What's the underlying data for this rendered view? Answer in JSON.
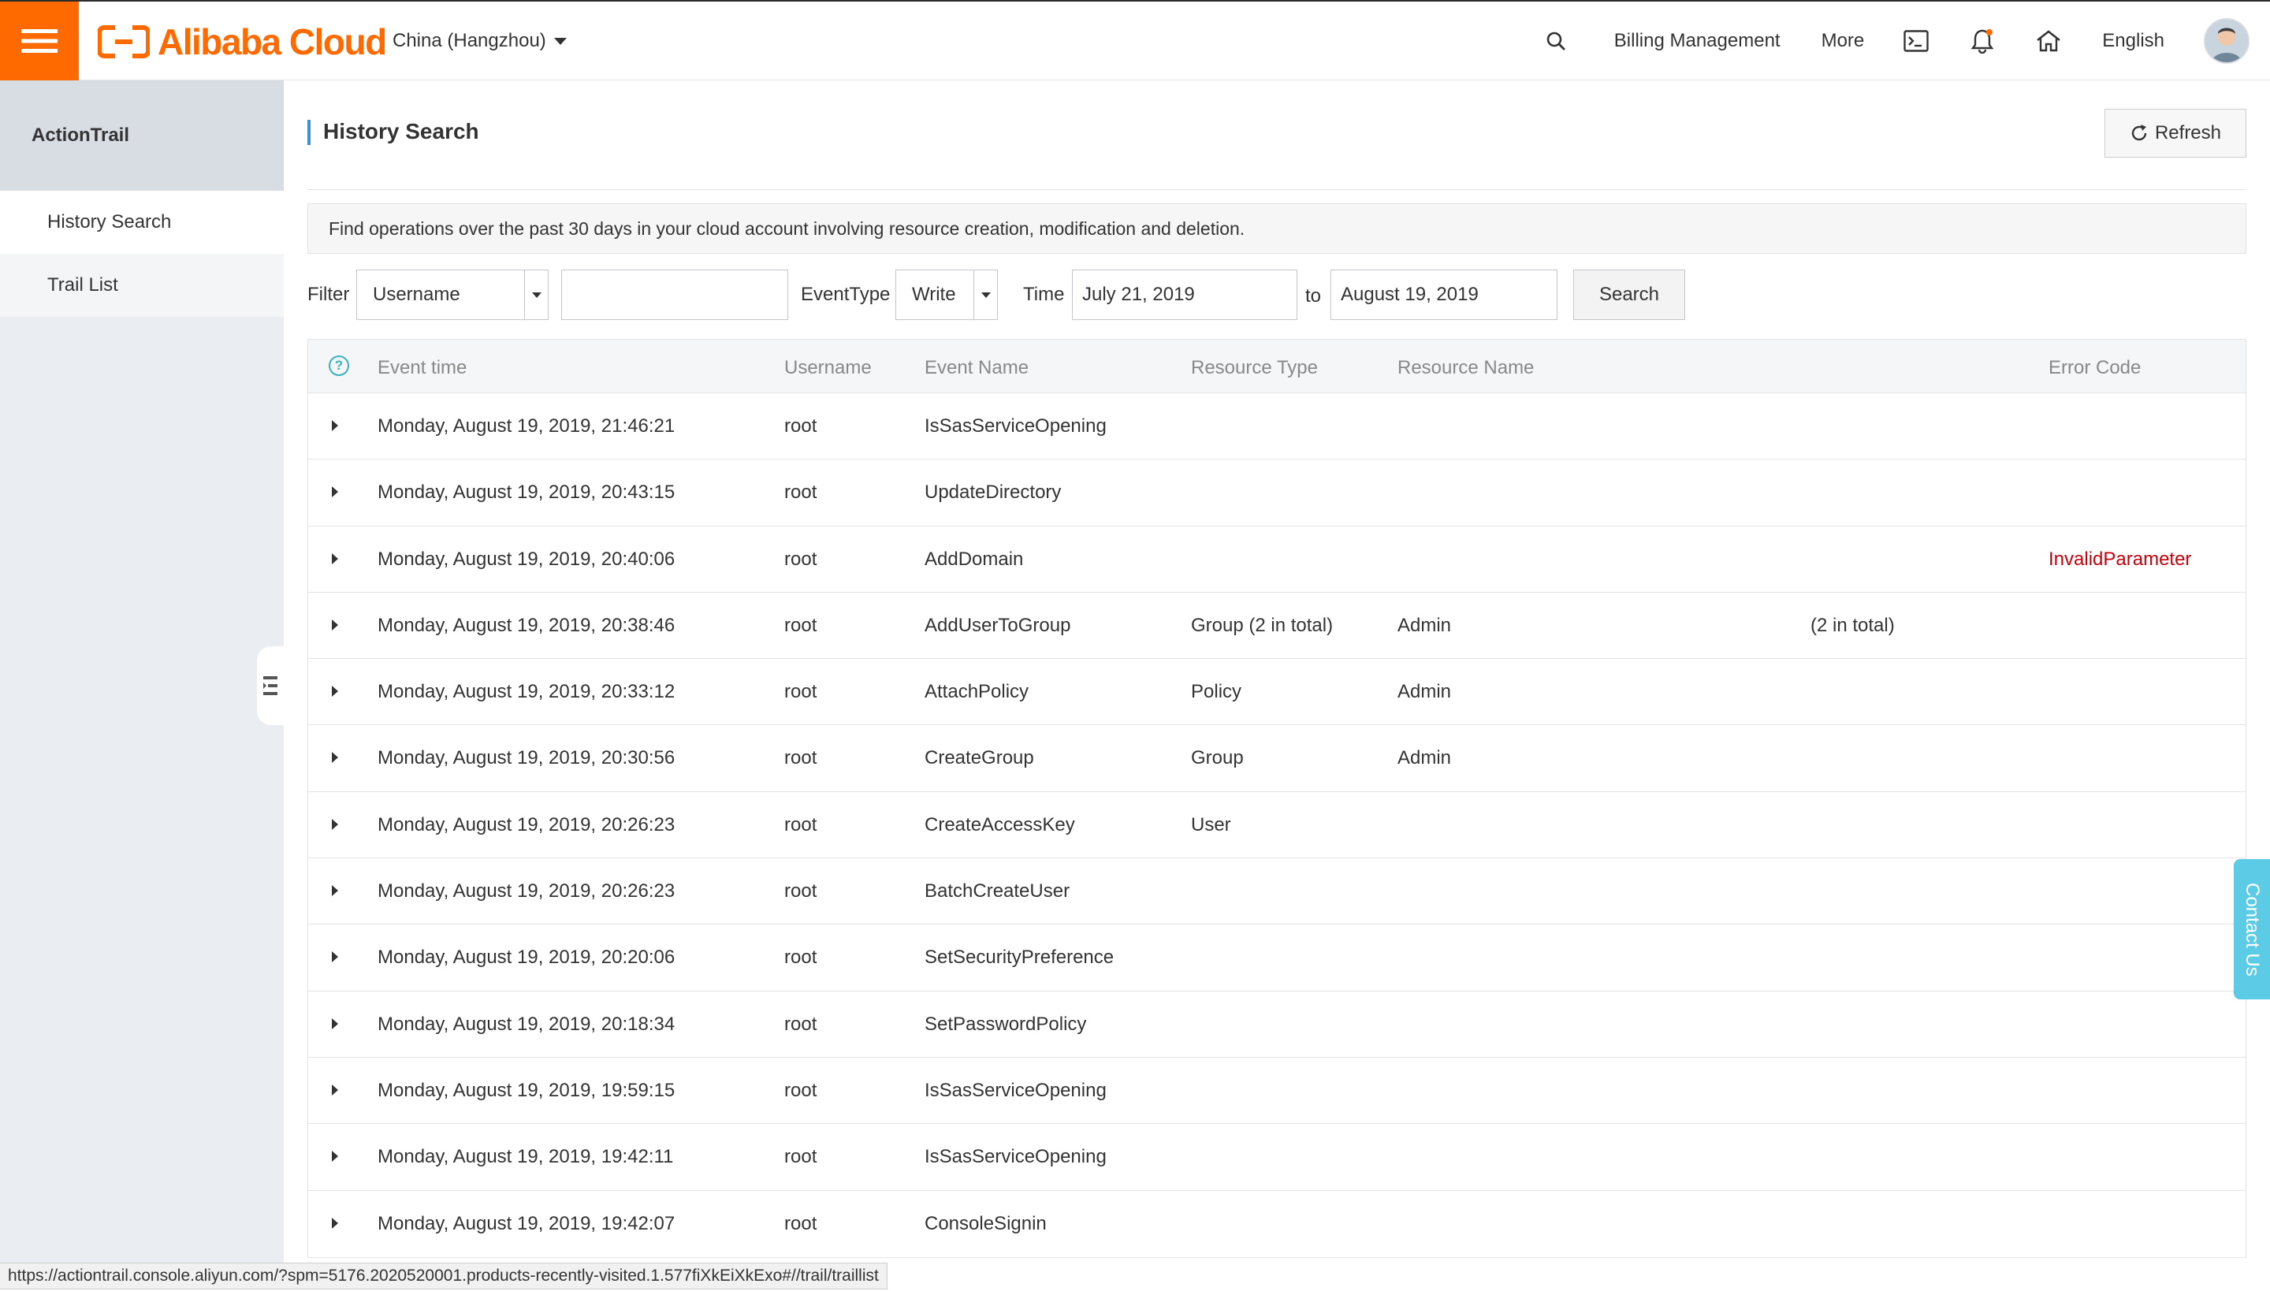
{
  "topbar": {
    "brand": "Alibaba Cloud",
    "region": "China (Hangzhou)",
    "billing": "Billing Management",
    "more": "More",
    "language": "English"
  },
  "sidebar": {
    "title": "ActionTrail",
    "items": [
      {
        "label": "History Search"
      },
      {
        "label": "Trail List"
      }
    ]
  },
  "page": {
    "title": "History Search",
    "refresh_label": "Refresh",
    "notice": "Find operations over the past 30 days in your cloud account involving resource creation, modification and deletion."
  },
  "filters": {
    "filter_label": "Filter",
    "filter_select": "Username",
    "filter_value": "",
    "eventtype_label": "EventType",
    "eventtype_select": "Write",
    "time_label": "Time",
    "start_date": "July 21, 2019",
    "to_label": "to",
    "end_date": "August 19, 2019",
    "search_label": "Search"
  },
  "table": {
    "headers": {
      "event_time": "Event time",
      "username": "Username",
      "event_name": "Event Name",
      "resource_type": "Resource Type",
      "resource_name": "Resource Name",
      "error_code": "Error Code"
    },
    "rows": [
      {
        "time": "Monday, August 19, 2019, 21:46:21",
        "user": "root",
        "event": "IsSasServiceOpening",
        "rtype": "",
        "rname": "",
        "extra": "",
        "error": ""
      },
      {
        "time": "Monday, August 19, 2019, 20:43:15",
        "user": "root",
        "event": "UpdateDirectory",
        "rtype": "",
        "rname": "",
        "extra": "",
        "error": ""
      },
      {
        "time": "Monday, August 19, 2019, 20:40:06",
        "user": "root",
        "event": "AddDomain",
        "rtype": "",
        "rname": "",
        "extra": "",
        "error": "InvalidParameter"
      },
      {
        "time": "Monday, August 19, 2019, 20:38:46",
        "user": "root",
        "event": "AddUserToGroup",
        "rtype": "Group (2 in total)",
        "rname": "Admin",
        "extra": "(2 in total)",
        "error": ""
      },
      {
        "time": "Monday, August 19, 2019, 20:33:12",
        "user": "root",
        "event": "AttachPolicy",
        "rtype": "Policy",
        "rname": "Admin",
        "extra": "",
        "error": ""
      },
      {
        "time": "Monday, August 19, 2019, 20:30:56",
        "user": "root",
        "event": "CreateGroup",
        "rtype": "Group",
        "rname": "Admin",
        "extra": "",
        "error": ""
      },
      {
        "time": "Monday, August 19, 2019, 20:26:23",
        "user": "root",
        "event": "CreateAccessKey",
        "rtype": "User",
        "rname": "",
        "extra": "",
        "error": ""
      },
      {
        "time": "Monday, August 19, 2019, 20:26:23",
        "user": "root",
        "event": "BatchCreateUser",
        "rtype": "",
        "rname": "",
        "extra": "",
        "error": ""
      },
      {
        "time": "Monday, August 19, 2019, 20:20:06",
        "user": "root",
        "event": "SetSecurityPreference",
        "rtype": "",
        "rname": "",
        "extra": "",
        "error": ""
      },
      {
        "time": "Monday, August 19, 2019, 20:18:34",
        "user": "root",
        "event": "SetPasswordPolicy",
        "rtype": "",
        "rname": "",
        "extra": "",
        "error": ""
      },
      {
        "time": "Monday, August 19, 2019, 19:59:15",
        "user": "root",
        "event": "IsSasServiceOpening",
        "rtype": "",
        "rname": "",
        "extra": "",
        "error": ""
      },
      {
        "time": "Monday, August 19, 2019, 19:42:11",
        "user": "root",
        "event": "IsSasServiceOpening",
        "rtype": "",
        "rname": "",
        "extra": "",
        "error": ""
      },
      {
        "time": "Monday, August 19, 2019, 19:42:07",
        "user": "root",
        "event": "ConsoleSignin",
        "rtype": "",
        "rname": "",
        "extra": "",
        "error": ""
      }
    ]
  },
  "status_bar": "https://actiontrail.console.aliyun.com/?spm=5176.2020520001.products-recently-visited.1.577fiXkEiXkExo#//trail/traillist",
  "contact": "Contact Us",
  "icons": {
    "menu": "hamburger-icon",
    "search": "search-icon",
    "terminal": "terminal-icon",
    "bell": "bell-icon",
    "home": "home-icon",
    "refresh": "refresh-icon",
    "help": "help-icon",
    "collapse": "sidebar-collapse-icon"
  },
  "colors": {
    "brand": "#ff6a00",
    "accent": "#3b8fd4",
    "error": "#c7000b",
    "contact": "#5ccbe6"
  }
}
